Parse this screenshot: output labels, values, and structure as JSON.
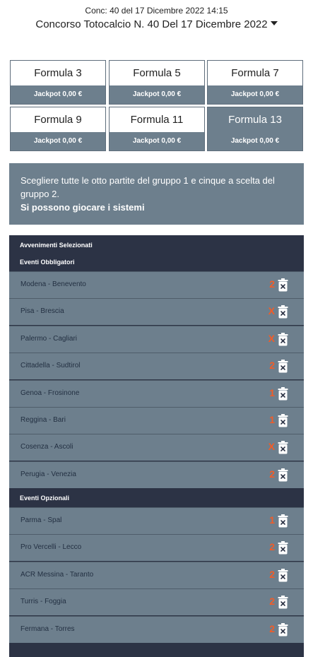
{
  "header": {
    "conc_line": "Conc: 40 del 17 Dicembre 2022 14:15",
    "contest_selector": "Concorso Totocalcio N. 40 Del 17 Dicembre 2022"
  },
  "formulas": [
    {
      "name": "Formula 3",
      "jackpot": "Jackpot 0,00 €",
      "active": false
    },
    {
      "name": "Formula 5",
      "jackpot": "Jackpot 0,00 €",
      "active": false
    },
    {
      "name": "Formula 7",
      "jackpot": "Jackpot 0,00 €",
      "active": false
    },
    {
      "name": "Formula 9",
      "jackpot": "Jackpot 0,00 €",
      "active": false
    },
    {
      "name": "Formula 11",
      "jackpot": "Jackpot 0,00 €",
      "active": false
    },
    {
      "name": "Formula 13",
      "jackpot": "Jackpot 0,00 €",
      "active": true
    }
  ],
  "info": {
    "text": "Scegliere tutte le otto partite del gruppo 1 e cinque a scelta del gruppo 2.",
    "bold": "Si possono giocare i sistemi"
  },
  "events": {
    "title": "Avvenimenti Selezionati",
    "mandatory_title": "Eventi Obbligatori",
    "optional_title": "Eventi Opzionali",
    "mandatory": [
      {
        "match": "Modena - Benevento",
        "pick": "2"
      },
      {
        "match": "Pisa - Brescia",
        "pick": "X"
      },
      {
        "match": "Palermo - Cagliari",
        "pick": "X"
      },
      {
        "match": "Cittadella - Sudtirol",
        "pick": "2"
      },
      {
        "match": "Genoa - Frosinone",
        "pick": "1"
      },
      {
        "match": "Reggina - Bari",
        "pick": "1"
      },
      {
        "match": "Cosenza - Ascoli",
        "pick": "X"
      },
      {
        "match": "Perugia - Venezia",
        "pick": "2"
      }
    ],
    "optional": [
      {
        "match": "Parma - Spal",
        "pick": "1"
      },
      {
        "match": "Pro Vercelli - Lecco",
        "pick": "2"
      },
      {
        "match": "ACR Messina - Taranto",
        "pick": "2"
      },
      {
        "match": "Turris - Foggia",
        "pick": "2"
      },
      {
        "match": "Fermana - Torres",
        "pick": "2"
      }
    ]
  },
  "colors": {
    "accent_pick": "#f25c27",
    "panel": "#6d7f8d",
    "dark": "#2c3345"
  }
}
